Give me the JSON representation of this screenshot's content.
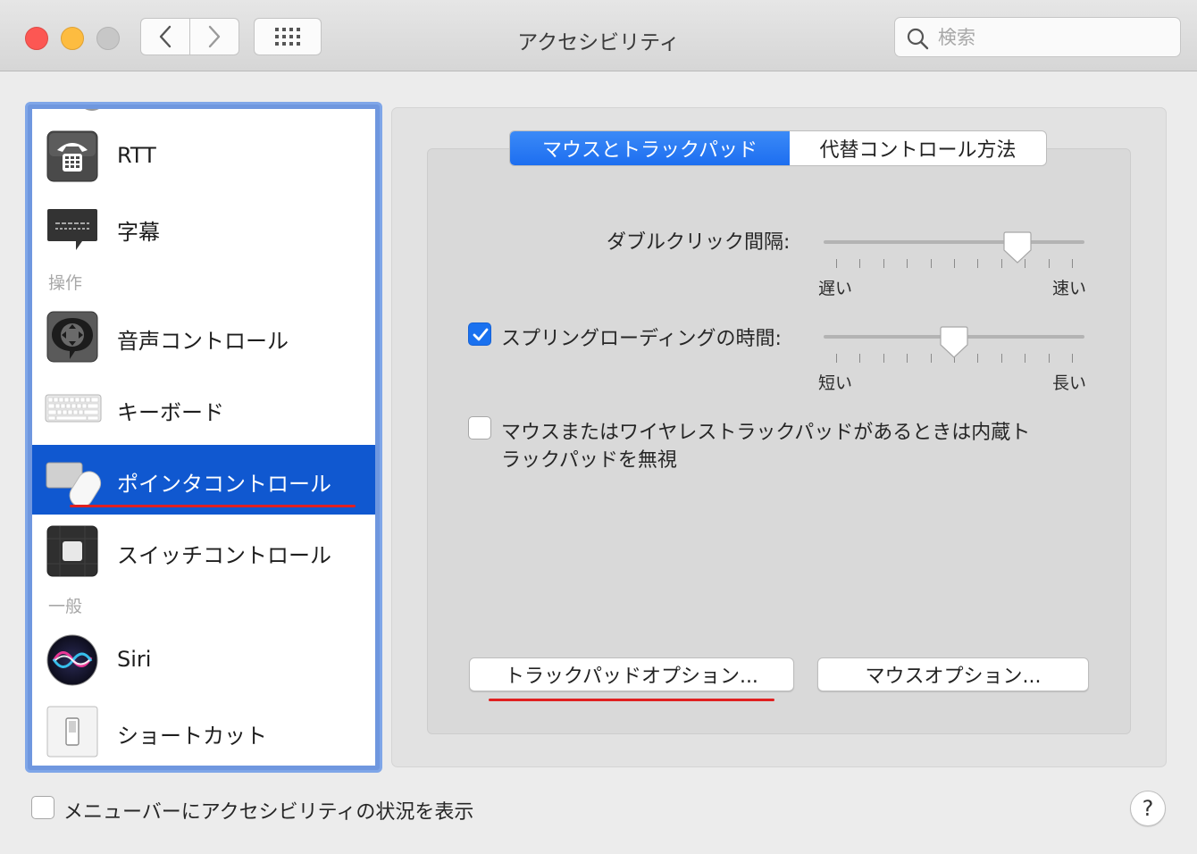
{
  "window": {
    "title": "アクセシビリティ",
    "search_placeholder": "検索"
  },
  "sidebar": {
    "items": [
      {
        "label": "RTT",
        "icon": "rtt-phone-icon"
      },
      {
        "label": "字幕",
        "icon": "captions-icon"
      },
      {
        "label": "音声コントロール",
        "icon": "voice-control-icon"
      },
      {
        "label": "キーボード",
        "icon": "keyboard-icon"
      },
      {
        "label": "ポインタコントロール",
        "icon": "pointer-control-icon",
        "selected": true
      },
      {
        "label": "スイッチコントロール",
        "icon": "switch-control-icon"
      },
      {
        "label": "Siri",
        "icon": "siri-icon"
      },
      {
        "label": "ショートカット",
        "icon": "shortcut-icon"
      }
    ],
    "sections": {
      "motor": "操作",
      "general": "一般"
    }
  },
  "tabs": [
    {
      "label": "マウスとトラックパッド",
      "active": true
    },
    {
      "label": "代替コントロール方法",
      "active": false
    }
  ],
  "settings": {
    "double_click": {
      "label": "ダブルクリック間隔:",
      "min_label": "遅い",
      "max_label": "速い",
      "value_fraction": 0.77
    },
    "spring_loading": {
      "label": "スプリングローディングの時間:",
      "checked": true,
      "min_label": "短い",
      "max_label": "長い",
      "value_fraction": 0.5
    },
    "ignore_trackpad": {
      "label_line1": "マウスまたはワイヤレストラックパッドがあるときは内蔵ト",
      "label_line2": "ラックパッドを無視",
      "checked": false
    }
  },
  "buttons": {
    "trackpad_options": "トラックパッドオプション...",
    "mouse_options": "マウスオプション...",
    "help": "?"
  },
  "footer": {
    "show_in_menubar": "メニューバーにアクセシビリティの状況を表示",
    "checked": false
  },
  "colors": {
    "accent": "#1a71ef",
    "selection": "#1058d0",
    "annotation_red": "#e02020"
  }
}
